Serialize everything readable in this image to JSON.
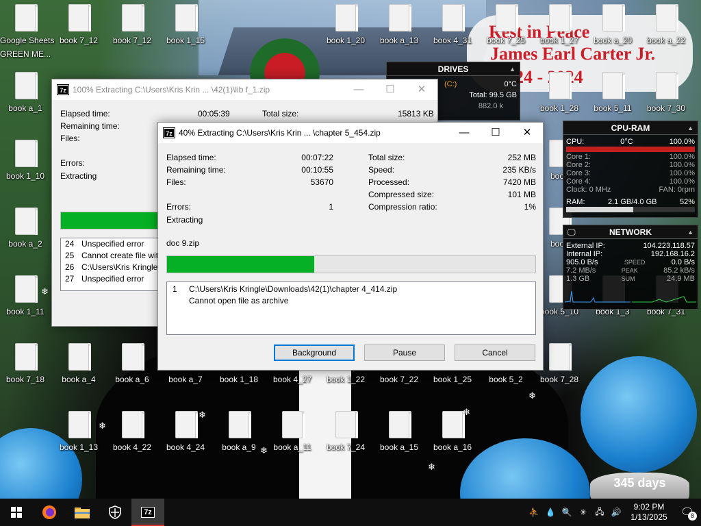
{
  "wallpaper": {
    "memorial_line1": "Rest in Peace",
    "memorial_line2": "James Earl Carter Jr.",
    "memorial_line3": "24 - 2024",
    "snowglobe_caption": "345 days"
  },
  "desktop_icons": [
    {
      "label": "Google Sheets"
    },
    {
      "label": "GREEN ME..."
    },
    {
      "label": "book 7_12"
    },
    {
      "label": "book 7_12"
    },
    {
      "label": "book 1_15"
    },
    {
      "label": "book 1_20"
    },
    {
      "label": "book a_13"
    },
    {
      "label": "book 4_31"
    },
    {
      "label": "book 7_25"
    },
    {
      "label": "book 1_27"
    },
    {
      "label": "book a_20"
    },
    {
      "label": "book a_22"
    },
    {
      "label": "book a_1"
    },
    {
      "label": "book 1_28"
    },
    {
      "label": "book 5_11"
    },
    {
      "label": "book 7_30"
    },
    {
      "label": "book 1_10"
    },
    {
      "label": "book a_2"
    },
    {
      "label": "book 1_11"
    },
    {
      "label": "book 5_10"
    },
    {
      "label": "book 1_3"
    },
    {
      "label": "book 7_31"
    },
    {
      "label": "book 7_18"
    },
    {
      "label": "book a_4"
    },
    {
      "label": "book a_6"
    },
    {
      "label": "book a_7"
    },
    {
      "label": "book 1_18"
    },
    {
      "label": "book 4_27"
    },
    {
      "label": "book 1_22"
    },
    {
      "label": "book 7_22"
    },
    {
      "label": "book 1_25"
    },
    {
      "label": "book 5_2"
    },
    {
      "label": "book 7_28"
    },
    {
      "label": "book 1_13"
    },
    {
      "label": "book 4_22"
    },
    {
      "label": "book 4_24"
    },
    {
      "label": "book a_9"
    },
    {
      "label": "book a_11"
    },
    {
      "label": "book 7_24"
    },
    {
      "label": "book a_15"
    },
    {
      "label": "book a_16"
    },
    {
      "label": "book"
    },
    {
      "label": "book"
    }
  ],
  "drives": {
    "title": "DRIVES",
    "drive": "(C:)",
    "temp": "0°C",
    "total": "Total: 99.5 GB",
    "rate": "882.0 k"
  },
  "cpu_ram": {
    "title": "CPU-RAM",
    "cpu_label": "CPU:",
    "cpu_temp": "0°C",
    "cpu_pct": "100.0%",
    "cores": [
      {
        "name": "Core 1:",
        "value": "100.0%"
      },
      {
        "name": "Core 2:",
        "value": "100.0%"
      },
      {
        "name": "Core 3:",
        "value": "100.0%"
      },
      {
        "name": "Core 4:",
        "value": "100.0%"
      }
    ],
    "clock": "Clock: 0 MHz",
    "fan": "FAN: 0rpm",
    "ram_label": "RAM:",
    "ram_value": "2.1 GB/4.0 GB",
    "ram_pct": "52%",
    "cpu_fraction": 1.0,
    "ram_fraction": 0.52
  },
  "network": {
    "title": "NETWORK",
    "external_label": "External IP:",
    "external_ip": "104.223.118.57",
    "internal_label": "Internal IP:",
    "internal_ip": "192.168.16.2",
    "speed_down": "905.0 B/s",
    "speed_label": "SPEED",
    "speed_up": "0.0 B/s",
    "peak_down": "7.2 MB/s",
    "peak_label": "PEAK",
    "peak_up": "85.2 kB/s",
    "sum_down": "1.3 GB",
    "sum_label": "SUM",
    "sum_up": "24.9 MB"
  },
  "back_window": {
    "title": "100% Extracting C:\\Users\\Kris Krin ... \\42(1)\\lib f_1.zip",
    "elapsed_label": "Elapsed time:",
    "elapsed_value": "00:05:39",
    "total_size_label": "Total size:",
    "total_size_value": "15813 KB",
    "remaining_label": "Remaining time:",
    "files_label": "Files:",
    "errors_label": "Errors:",
    "status": "Extracting",
    "progress": 1.0,
    "log": [
      {
        "num": "24",
        "text": "Unspecified error"
      },
      {
        "num": "25",
        "text": "Cannot create file with a"
      },
      {
        "num": "26",
        "text": "C:\\Users\\Kris Kringle\\D"
      },
      {
        "num": "27",
        "text": "Unspecified error"
      }
    ]
  },
  "front_window": {
    "title": "40% Extracting C:\\Users\\Kris Krin ... \\chapter 5_454.zip",
    "elapsed_label": "Elapsed time:",
    "elapsed_value": "00:07:22",
    "remaining_label": "Remaining time:",
    "remaining_value": "00:10:55",
    "files_label": "Files:",
    "files_value": "53670",
    "errors_label": "Errors:",
    "errors_value": "1",
    "total_size_label": "Total size:",
    "total_size_value": "252 MB",
    "speed_label": "Speed:",
    "speed_value": "235 KB/s",
    "processed_label": "Processed:",
    "processed_value": "7420 MB",
    "compressed_label": "Compressed size:",
    "compressed_value": "101 MB",
    "ratio_label": "Compression ratio:",
    "ratio_value": "1%",
    "status": "Extracting",
    "current_file": "doc 9.zip",
    "progress": 0.4,
    "log_num": "1",
    "log_path": "C:\\Users\\Kris Kringle\\Downloads\\42(1)\\chapter 4_414.zip",
    "log_message": "Cannot open file as archive",
    "buttons": {
      "background": "Background",
      "pause": "Pause",
      "cancel": "Cancel"
    }
  },
  "taskbar": {
    "time": "9:02 PM",
    "date": "1/13/2025",
    "notification_count": "8",
    "app_7zip_label": "7z"
  }
}
